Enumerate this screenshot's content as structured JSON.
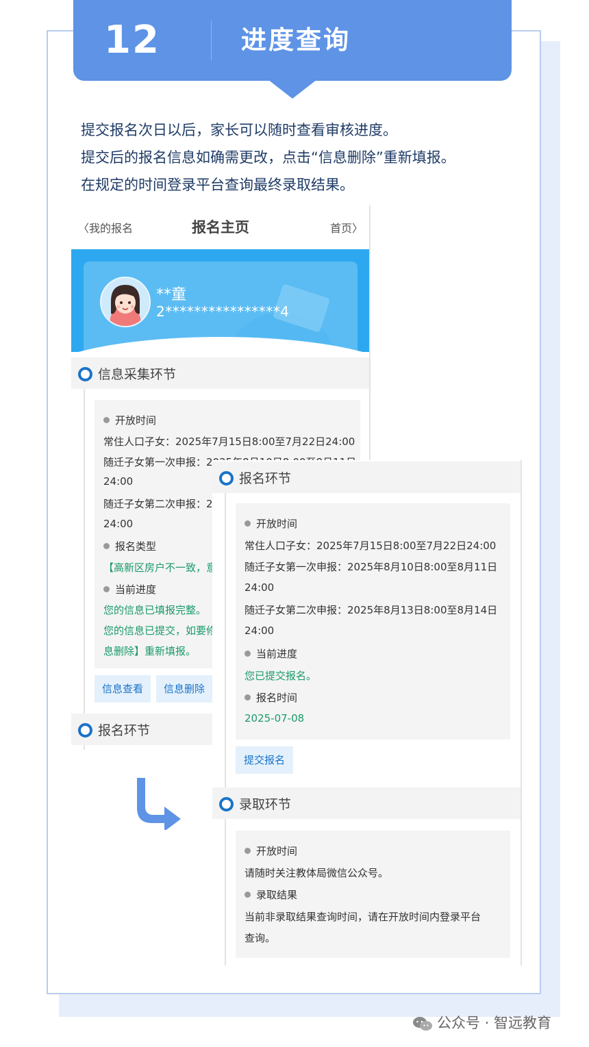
{
  "banner": {
    "number": "12",
    "title": "进度查询"
  },
  "intro": [
    "提交报名次日以后，家长可以随时查看审核进度。",
    "提交后的报名信息如确需更改，点击“信息删除”重新填报。",
    "在规定的时间登录平台查询最终录取结果。"
  ],
  "screen_a": {
    "nav": {
      "back": "我的报名",
      "title": "报名主页",
      "home": "首页"
    },
    "student": {
      "name": "**童",
      "id": "2****************4"
    },
    "section1": {
      "title": "信息采集环节",
      "rows": [
        "开放时间",
        "常住人口子女：2025年7月15日8:00至7月22日24:00",
        "随迁子女第一次申报：2025年8月10日8:00至8月11日",
        "24:00",
        "随迁子女第二次申报：2",
        "24:00",
        "报名类型",
        "【高新区房户不一致，意",
        "当前进度",
        "您的信息已填报完整。",
        "您的信息已提交，如要修",
        "息删除】重新填报。"
      ],
      "buttons": [
        "信息查看",
        "信息删除"
      ]
    },
    "section2": {
      "title": "报名环节"
    }
  },
  "screen_b": {
    "section1": {
      "title": "报名环节",
      "rows": [
        "开放时间",
        "常住人口子女：2025年7月15日8:00至7月22日24:00",
        "随迁子女第一次申报：2025年8月10日8:00至8月11日",
        "24:00",
        "随迁子女第二次申报：2025年8月13日8:00至8月14日",
        "24:00",
        "当前进度",
        "您已提交报名。",
        "报名时间",
        "2025-07-08"
      ],
      "button": "提交报名"
    },
    "section2": {
      "title": "录取环节",
      "rows": [
        "开放时间",
        "请随时关注教体局微信公众号。",
        "录取结果",
        "当前非录取结果查询时间，请在开放时间内登录平台",
        "查询。"
      ]
    }
  },
  "watermark": "公众号 · 智远教育",
  "colors": {
    "banner": "#5e93e6",
    "accent": "#1a73c8",
    "hero": "#2da8f0",
    "green": "#1a9a6a"
  }
}
